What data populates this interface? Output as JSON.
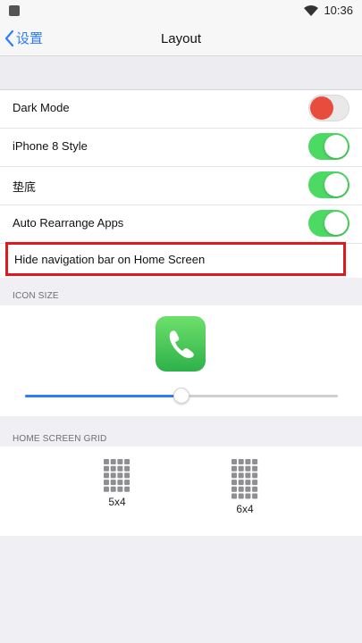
{
  "status_bar": {
    "time": "10:36",
    "wifi_icon": "wifi-icon",
    "app_icon": "app-notification-icon"
  },
  "nav": {
    "back_label": "设置",
    "title": "Layout"
  },
  "settings": {
    "dark_mode": {
      "label": "Dark Mode",
      "on": false
    },
    "iphone8_style": {
      "label": "iPhone 8 Style",
      "on": true
    },
    "dock": {
      "label": "垫底",
      "on": true
    },
    "auto_rearrange": {
      "label": "Auto Rearrange Apps",
      "on": true
    },
    "hide_nav": {
      "label": "Hide navigation bar on Home Screen"
    }
  },
  "icon_size": {
    "header": "ICON SIZE",
    "app_icon": "phone-icon",
    "value_fraction": 0.5
  },
  "home_grid": {
    "header": "HOME SCREEN GRID",
    "options": [
      {
        "label": "5x4",
        "cols": 4,
        "rows": 5
      },
      {
        "label": "6x4",
        "cols": 4,
        "rows": 6
      }
    ]
  },
  "colors": {
    "accent": "#2f7cf6",
    "toggle_on": "#4cd964",
    "highlight": "#e0191f",
    "dark_mode_knob": "#e74c3c"
  }
}
